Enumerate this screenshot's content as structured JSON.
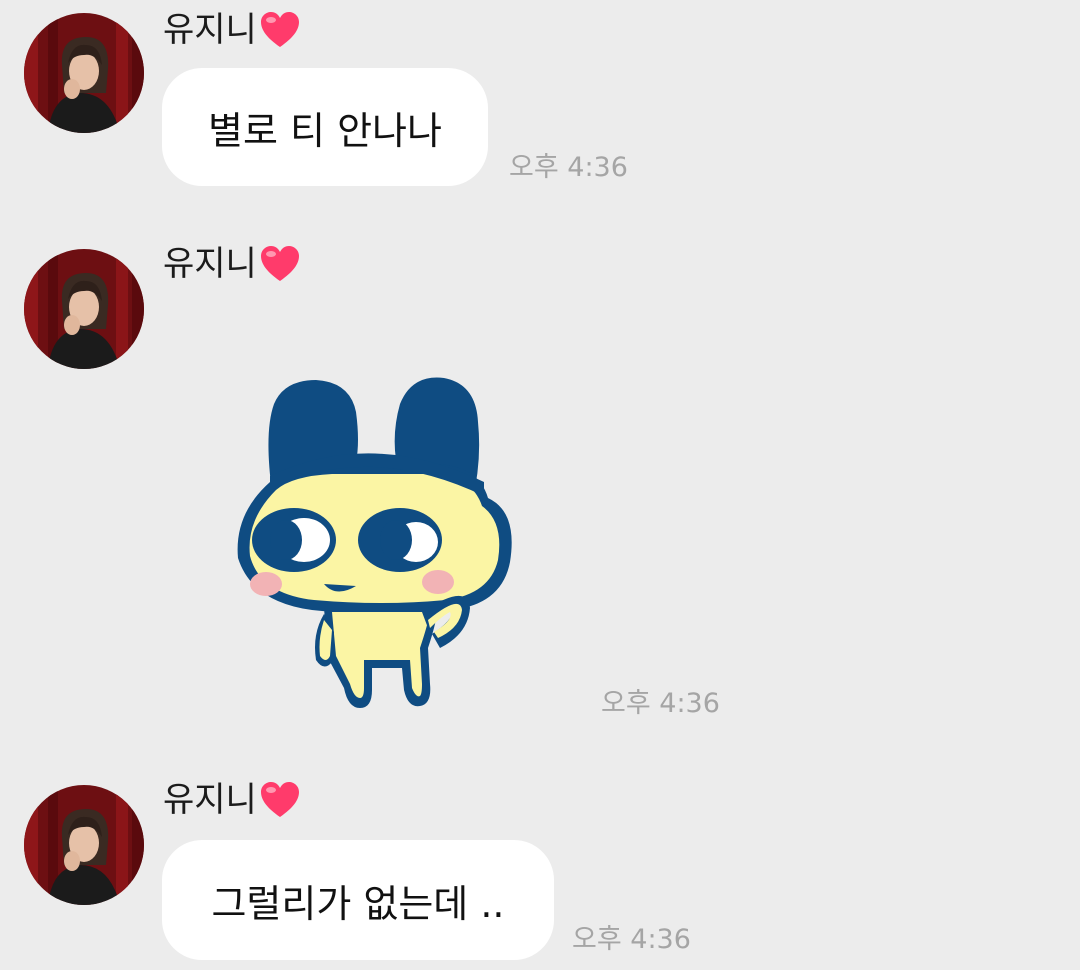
{
  "messages": [
    {
      "sender": "유지니",
      "text": "별로 티 안나나",
      "time": "오후 4:36"
    },
    {
      "sender": "유지니",
      "sticker": "tamagotchi-character-sticker",
      "time": "오후 4:36"
    },
    {
      "sender": "유지니",
      "text": "그럴리가 없는데 ..",
      "time": "오후 4:36"
    }
  ],
  "colors": {
    "background": "#ececec",
    "bubble": "#ffffff",
    "timestamp": "#a5a5a5",
    "heart": "#ff3b6b",
    "sticker_navy": "#0f4c82",
    "sticker_yellow": "#fbf5a4",
    "sticker_cheek": "#f2b3b5"
  },
  "icons": {
    "name_suffix": "heart-icon",
    "avatar": "profile-photo"
  }
}
